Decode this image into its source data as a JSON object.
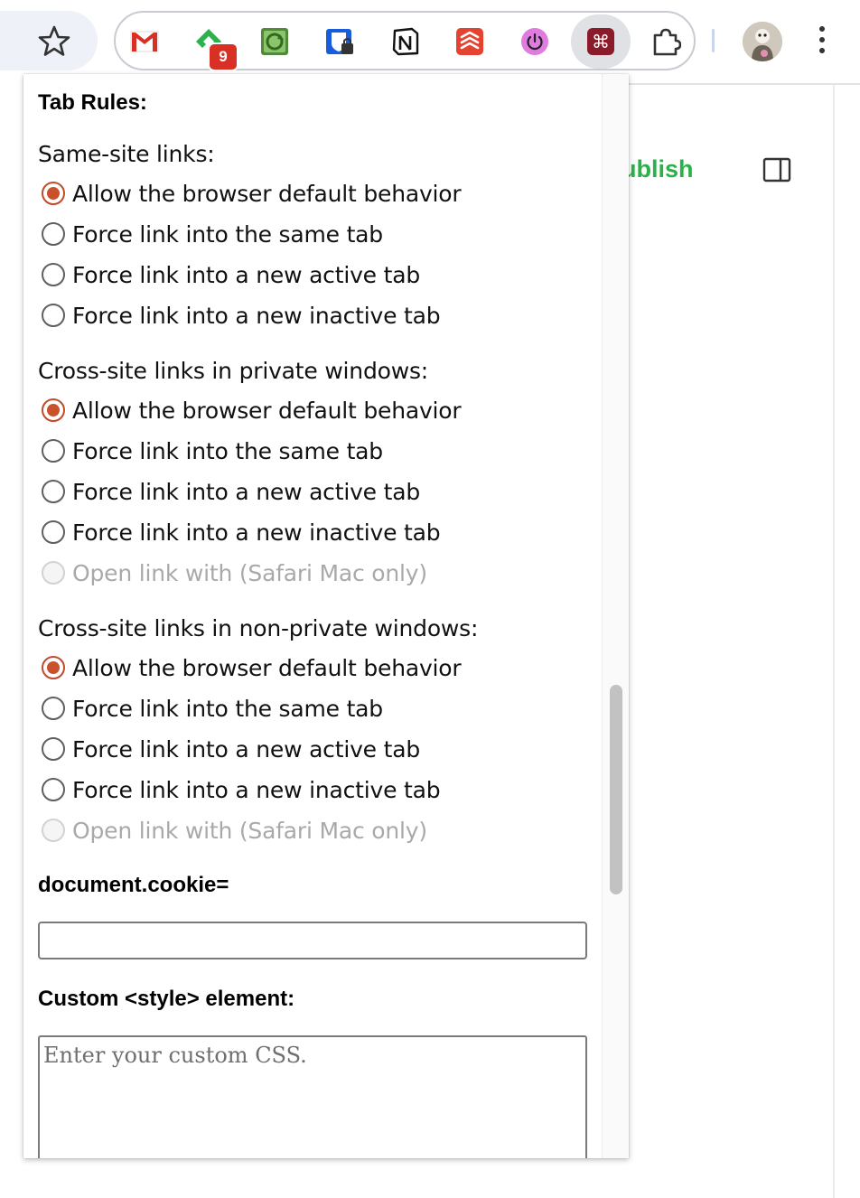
{
  "toolbar": {
    "extensions": [
      {
        "name": "gmail-extension-icon"
      },
      {
        "name": "feedly-extension-icon",
        "badge": "9"
      },
      {
        "name": "sync-extension-icon"
      },
      {
        "name": "bitwarden-extension-icon"
      },
      {
        "name": "notion-extension-icon"
      },
      {
        "name": "todoist-extension-icon"
      },
      {
        "name": "power-extension-icon"
      },
      {
        "name": "command-extension-icon"
      },
      {
        "name": "extensions-puzzle-icon"
      }
    ],
    "active_extension_color": "#8b1a2b"
  },
  "page": {
    "publish_label": "ublish",
    "publish_color": "#2bb14a"
  },
  "popup": {
    "tab_rules_heading": "Tab Rules:",
    "groups": [
      {
        "title": "Same-site links:",
        "options": [
          {
            "label": "Allow the browser default behavior",
            "checked": true,
            "disabled": false
          },
          {
            "label": "Force link into the same tab",
            "checked": false,
            "disabled": false
          },
          {
            "label": "Force link into a new active tab",
            "checked": false,
            "disabled": false
          },
          {
            "label": "Force link into a new inactive tab",
            "checked": false,
            "disabled": false
          }
        ]
      },
      {
        "title": "Cross-site links in private windows:",
        "options": [
          {
            "label": "Allow the browser default behavior",
            "checked": true,
            "disabled": false
          },
          {
            "label": "Force link into the same tab",
            "checked": false,
            "disabled": false
          },
          {
            "label": "Force link into a new active tab",
            "checked": false,
            "disabled": false
          },
          {
            "label": "Force link into a new inactive tab",
            "checked": false,
            "disabled": false
          },
          {
            "label": "Open link with (Safari Mac only)",
            "checked": false,
            "disabled": true
          }
        ]
      },
      {
        "title": "Cross-site links in non-private windows:",
        "options": [
          {
            "label": "Allow the browser default behavior",
            "checked": true,
            "disabled": false
          },
          {
            "label": "Force link into the same tab",
            "checked": false,
            "disabled": false
          },
          {
            "label": "Force link into a new active tab",
            "checked": false,
            "disabled": false
          },
          {
            "label": "Force link into a new inactive tab",
            "checked": false,
            "disabled": false
          },
          {
            "label": "Open link with (Safari Mac only)",
            "checked": false,
            "disabled": true
          }
        ]
      }
    ],
    "cookie_heading": "document.cookie=",
    "cookie_value": "",
    "style_heading": "Custom <style> element:",
    "style_placeholder": "Enter your custom CSS.",
    "accent_color": "#c9522c"
  }
}
